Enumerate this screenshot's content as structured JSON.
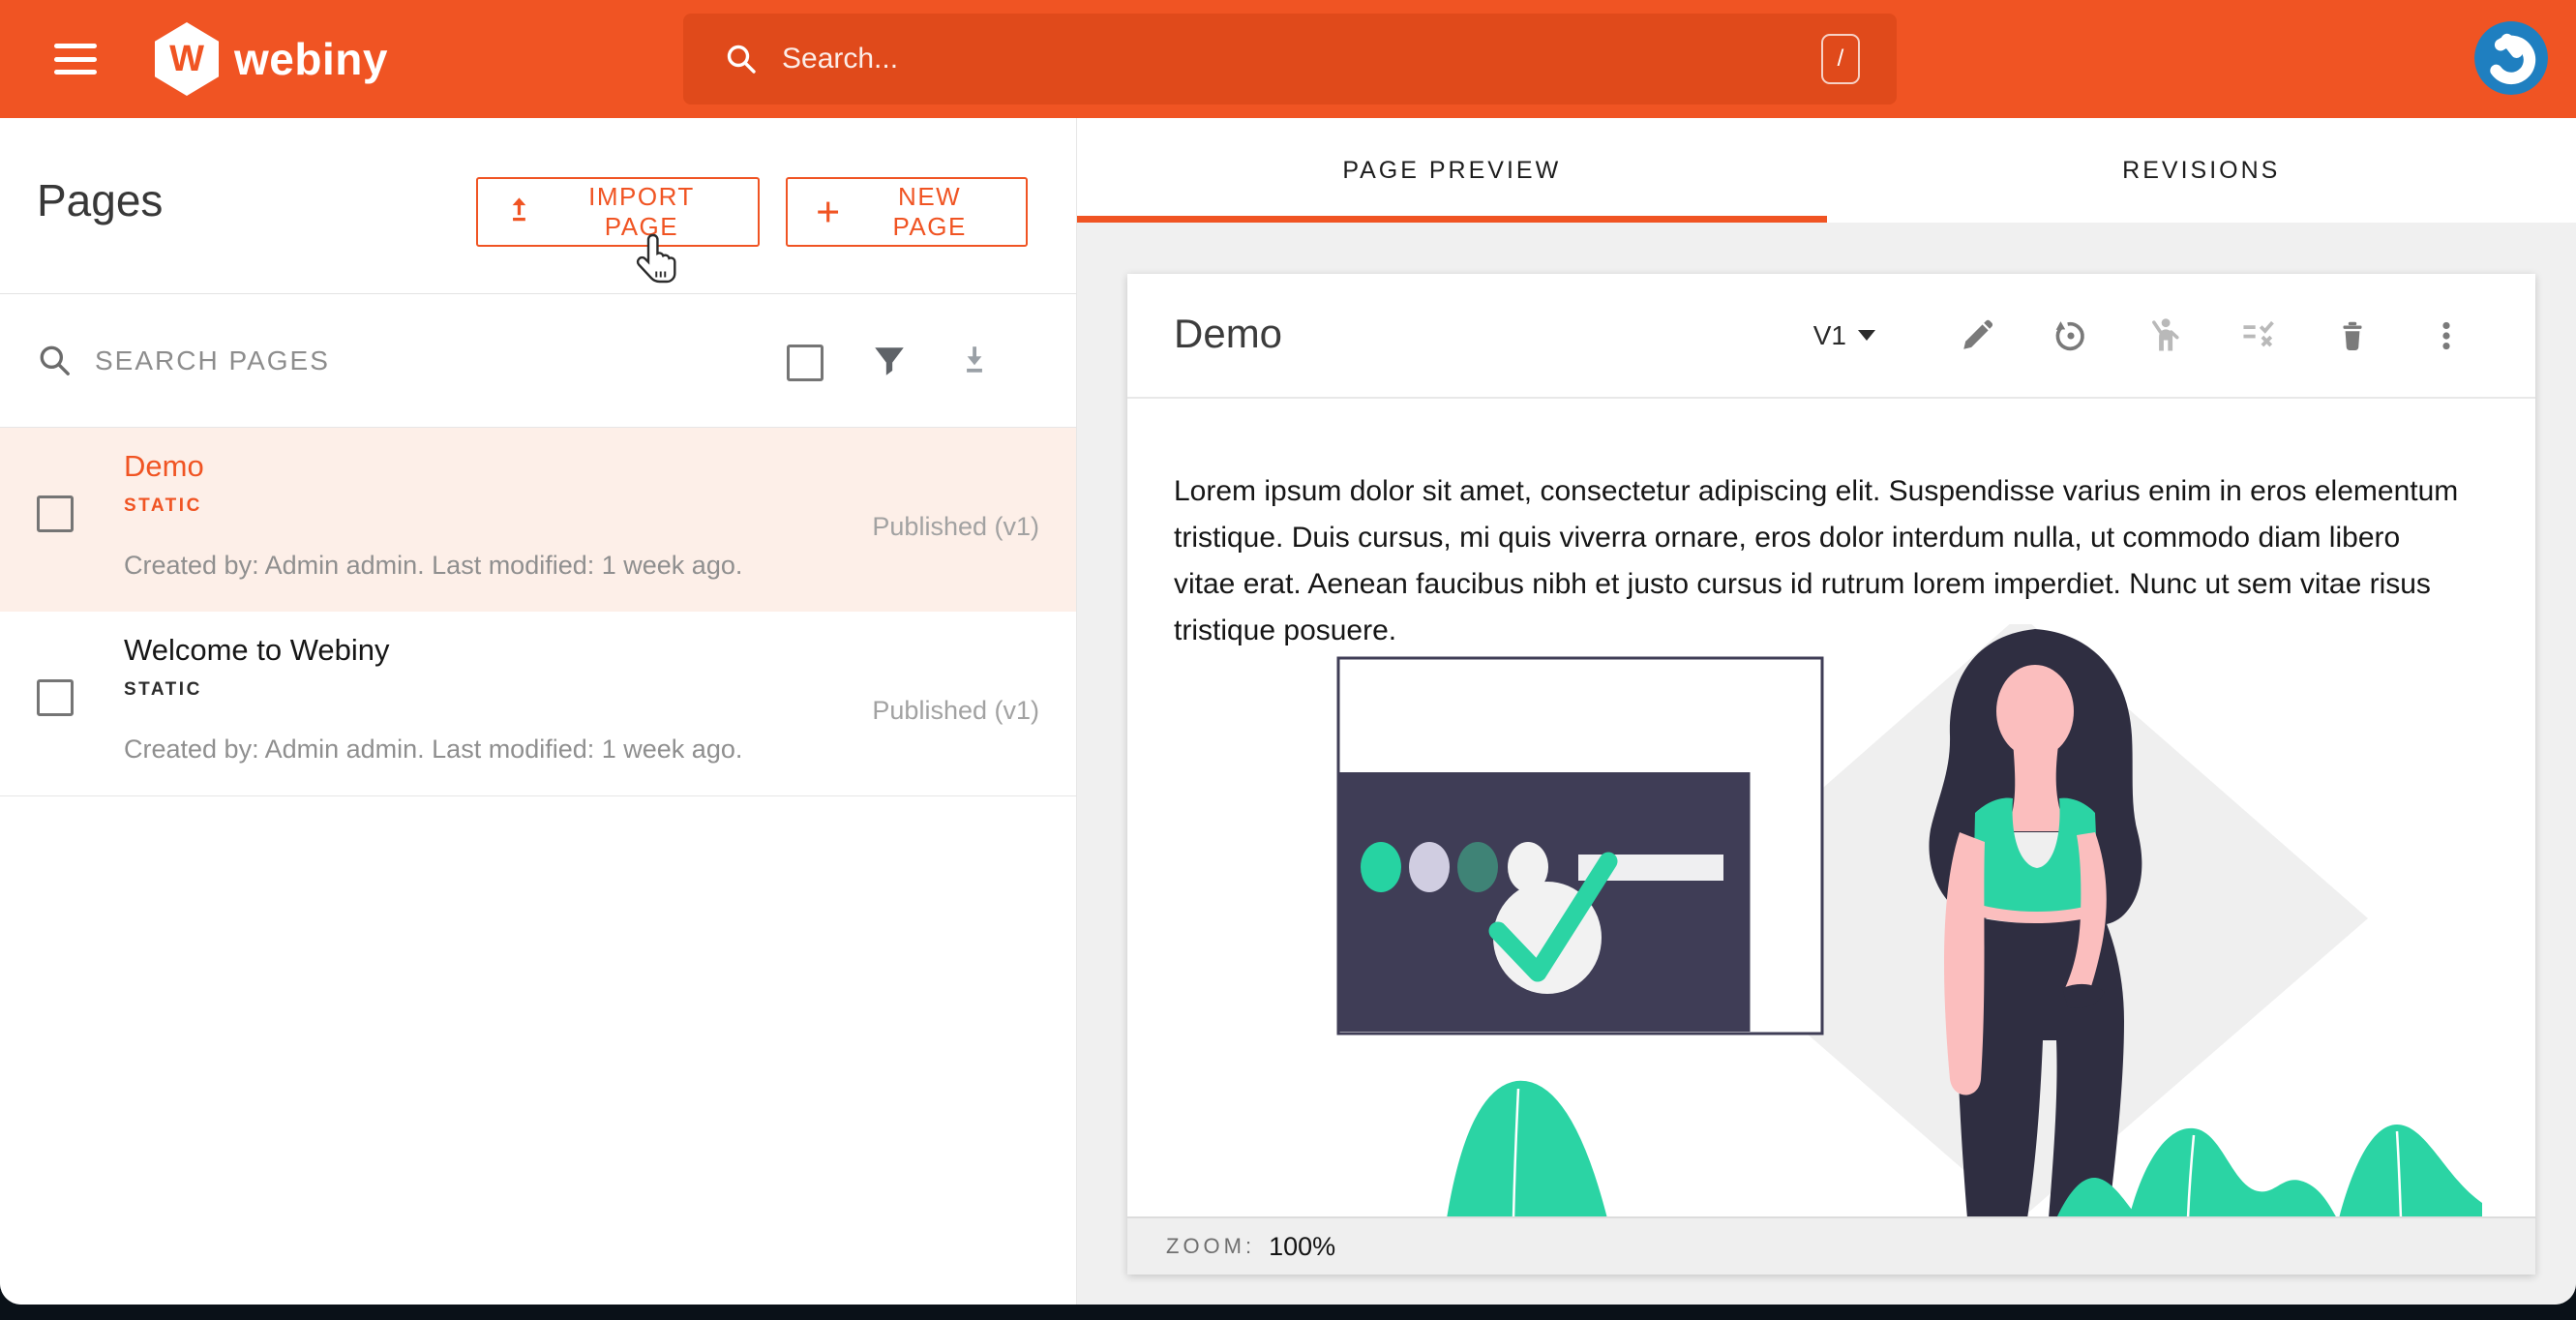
{
  "topbar": {
    "brand": "webiny",
    "search_placeholder": "Search...",
    "shortcut_key": "/"
  },
  "pages_panel": {
    "title": "Pages",
    "import_button_label": "IMPORT PAGE",
    "new_button_label": "NEW PAGE",
    "search_placeholder": "SEARCH PAGES",
    "items": [
      {
        "title": "Demo",
        "type": "STATIC",
        "status": "Published (v1)",
        "meta": "Created by: Admin admin. Last modified: 1 week ago.",
        "selected": true
      },
      {
        "title": "Welcome to Webiny",
        "type": "STATIC",
        "status": "Published (v1)",
        "meta": "Created by: Admin admin. Last modified: 1 week ago.",
        "selected": false
      }
    ]
  },
  "preview_panel": {
    "tabs": [
      {
        "label": "PAGE PREVIEW",
        "active": true
      },
      {
        "label": "REVISIONS",
        "active": false
      }
    ],
    "card": {
      "title": "Demo",
      "version_label": "V1",
      "body_text": "Lorem ipsum dolor sit amet, consectetur adipiscing elit. Suspendisse varius enim in eros elementum tristique. Duis cursus, mi quis viverra ornare, eros dolor interdum nulla, ut commodo diam libero vitae erat. Aenean faucibus nibh et justo cursus id rutrum lorem imperdiet. Nunc ut sem vitae risus tristique posuere.",
      "zoom_label": "ZOOM:",
      "zoom_value": "100%"
    }
  },
  "icons": {
    "topbar": [
      "menu-icon",
      "search-icon",
      "slash-shortcut-key",
      "user-avatar"
    ],
    "pages_panel": [
      "upload-icon",
      "plus-icon",
      "search-icon",
      "checkbox",
      "filter-icon",
      "export-icon"
    ],
    "preview_card": [
      "chevron-down-icon",
      "edit-pencil-icon",
      "history-icon",
      "request-review-icon",
      "unpublish-icon",
      "trash-icon",
      "more-vertical-icon"
    ]
  },
  "colors": {
    "accent": "#f05423",
    "topbar_bg": "#f05423",
    "topbar_search_bg": "#e04a1b",
    "selected_item_bg": "#fdefe8",
    "panel_bg": "#f0f0f0",
    "avatar_bg": "#1f7fc0",
    "illustration_navy": "#2f2e41",
    "illustration_panel": "#3f3d56",
    "illustration_teal": "#2bd4a4",
    "illustration_skin": "#fbbebe",
    "bottom_strip": "#0a1118"
  }
}
